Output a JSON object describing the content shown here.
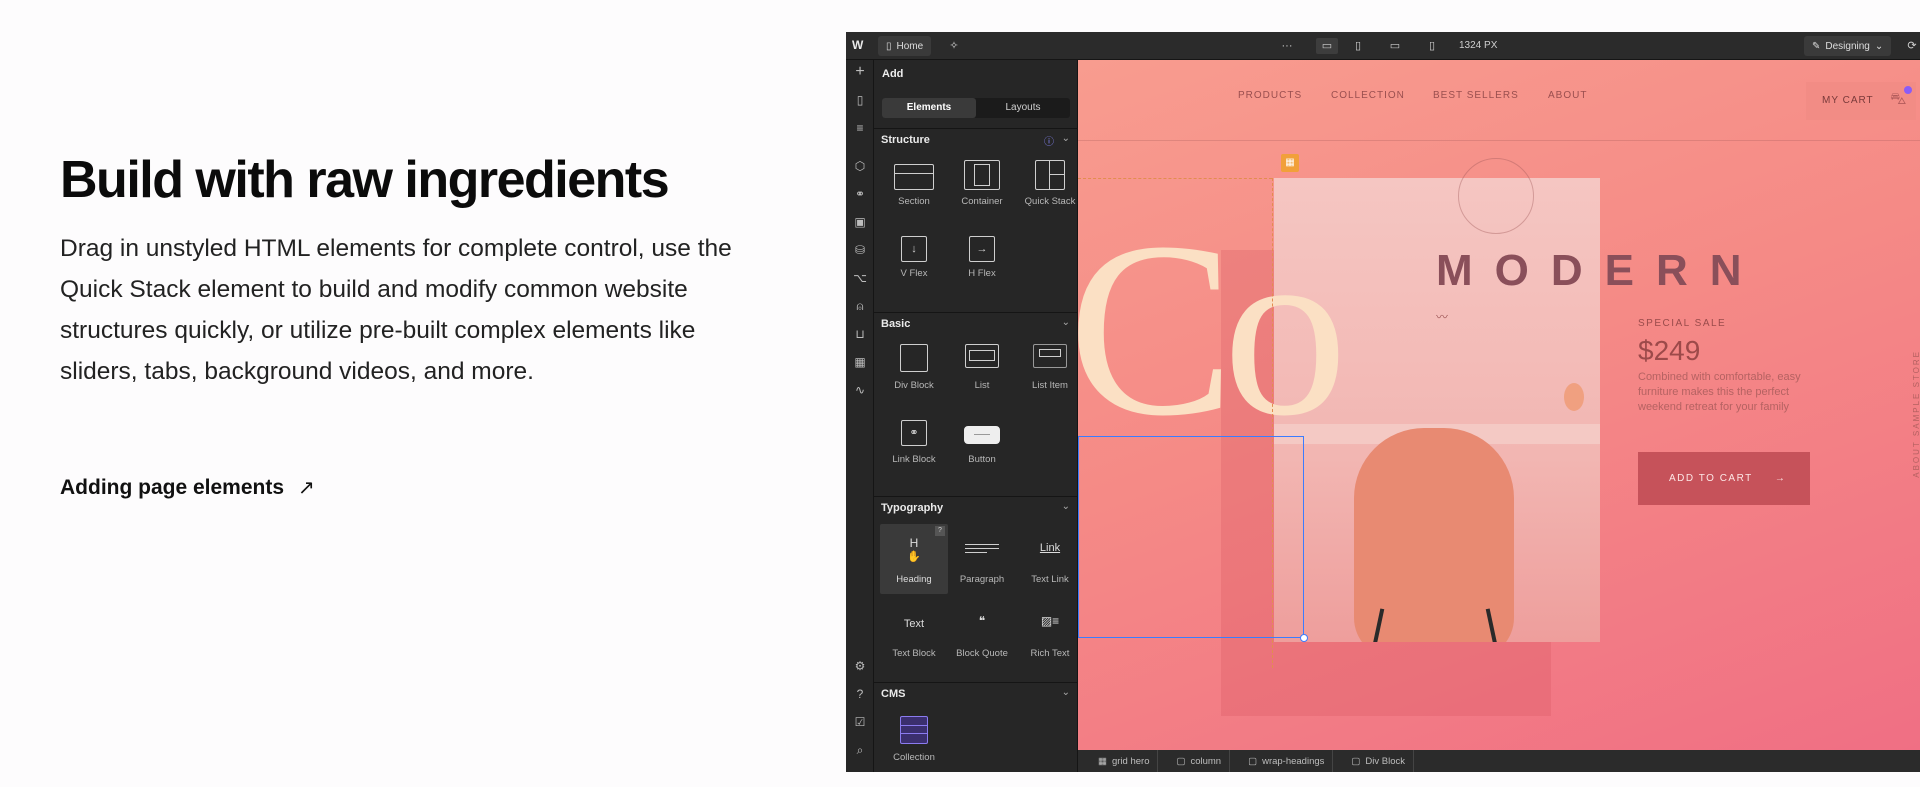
{
  "hero": {
    "title": "Build with raw ingredients",
    "description": "Drag in unstyled HTML elements for complete control, use the Quick Stack element to build and modify common website structures quickly, or utilize pre-built complex elements like sliders, tabs, background videos, and more.",
    "link_label": "Adding page elements"
  },
  "topbar": {
    "page_label": "Home",
    "more": "···",
    "viewport_label": "1324 PX",
    "mode_label": "Designing"
  },
  "panel": {
    "title": "Add",
    "tabs": [
      "Elements",
      "Layouts"
    ],
    "sections": {
      "structure": "Structure",
      "basic": "Basic",
      "typography": "Typography",
      "cms": "CMS"
    },
    "structure_items": [
      "Section",
      "Container",
      "Quick Stack",
      "V Flex",
      "H Flex"
    ],
    "basic_items": [
      "Div Block",
      "List",
      "List Item",
      "Link Block",
      "Button"
    ],
    "typography_items": [
      "Heading",
      "Paragraph",
      "Text Link",
      "Text Block",
      "Block Quote",
      "Rich Text"
    ],
    "cms_items": [
      "Collection"
    ],
    "heading_glyph": "H",
    "link_glyph": "Link",
    "text_glyph": "Text"
  },
  "site": {
    "nav": [
      "PRODUCTS",
      "COLLECTION",
      "BEST SELLERS",
      "ABOUT"
    ],
    "cart_label": "MY CART",
    "big_text": "Co",
    "headline": "MODERN",
    "sale_label": "SPECIAL SALE",
    "price": "$249",
    "blurb": "Combined with comfortable, easy furniture makes this the perfect weekend retreat for your family",
    "cta": "ADD TO CART",
    "side_text": "ABOUT SAMPLE STORE"
  },
  "breadcrumbs": [
    "grid hero",
    "column",
    "wrap-headings",
    "Div Block"
  ],
  "colors": {
    "editor_bg": "#1e1e1e",
    "canvas_pink": "#f58a86",
    "selection_blue": "#3b7cff",
    "cta_bg": "#c6525a"
  }
}
